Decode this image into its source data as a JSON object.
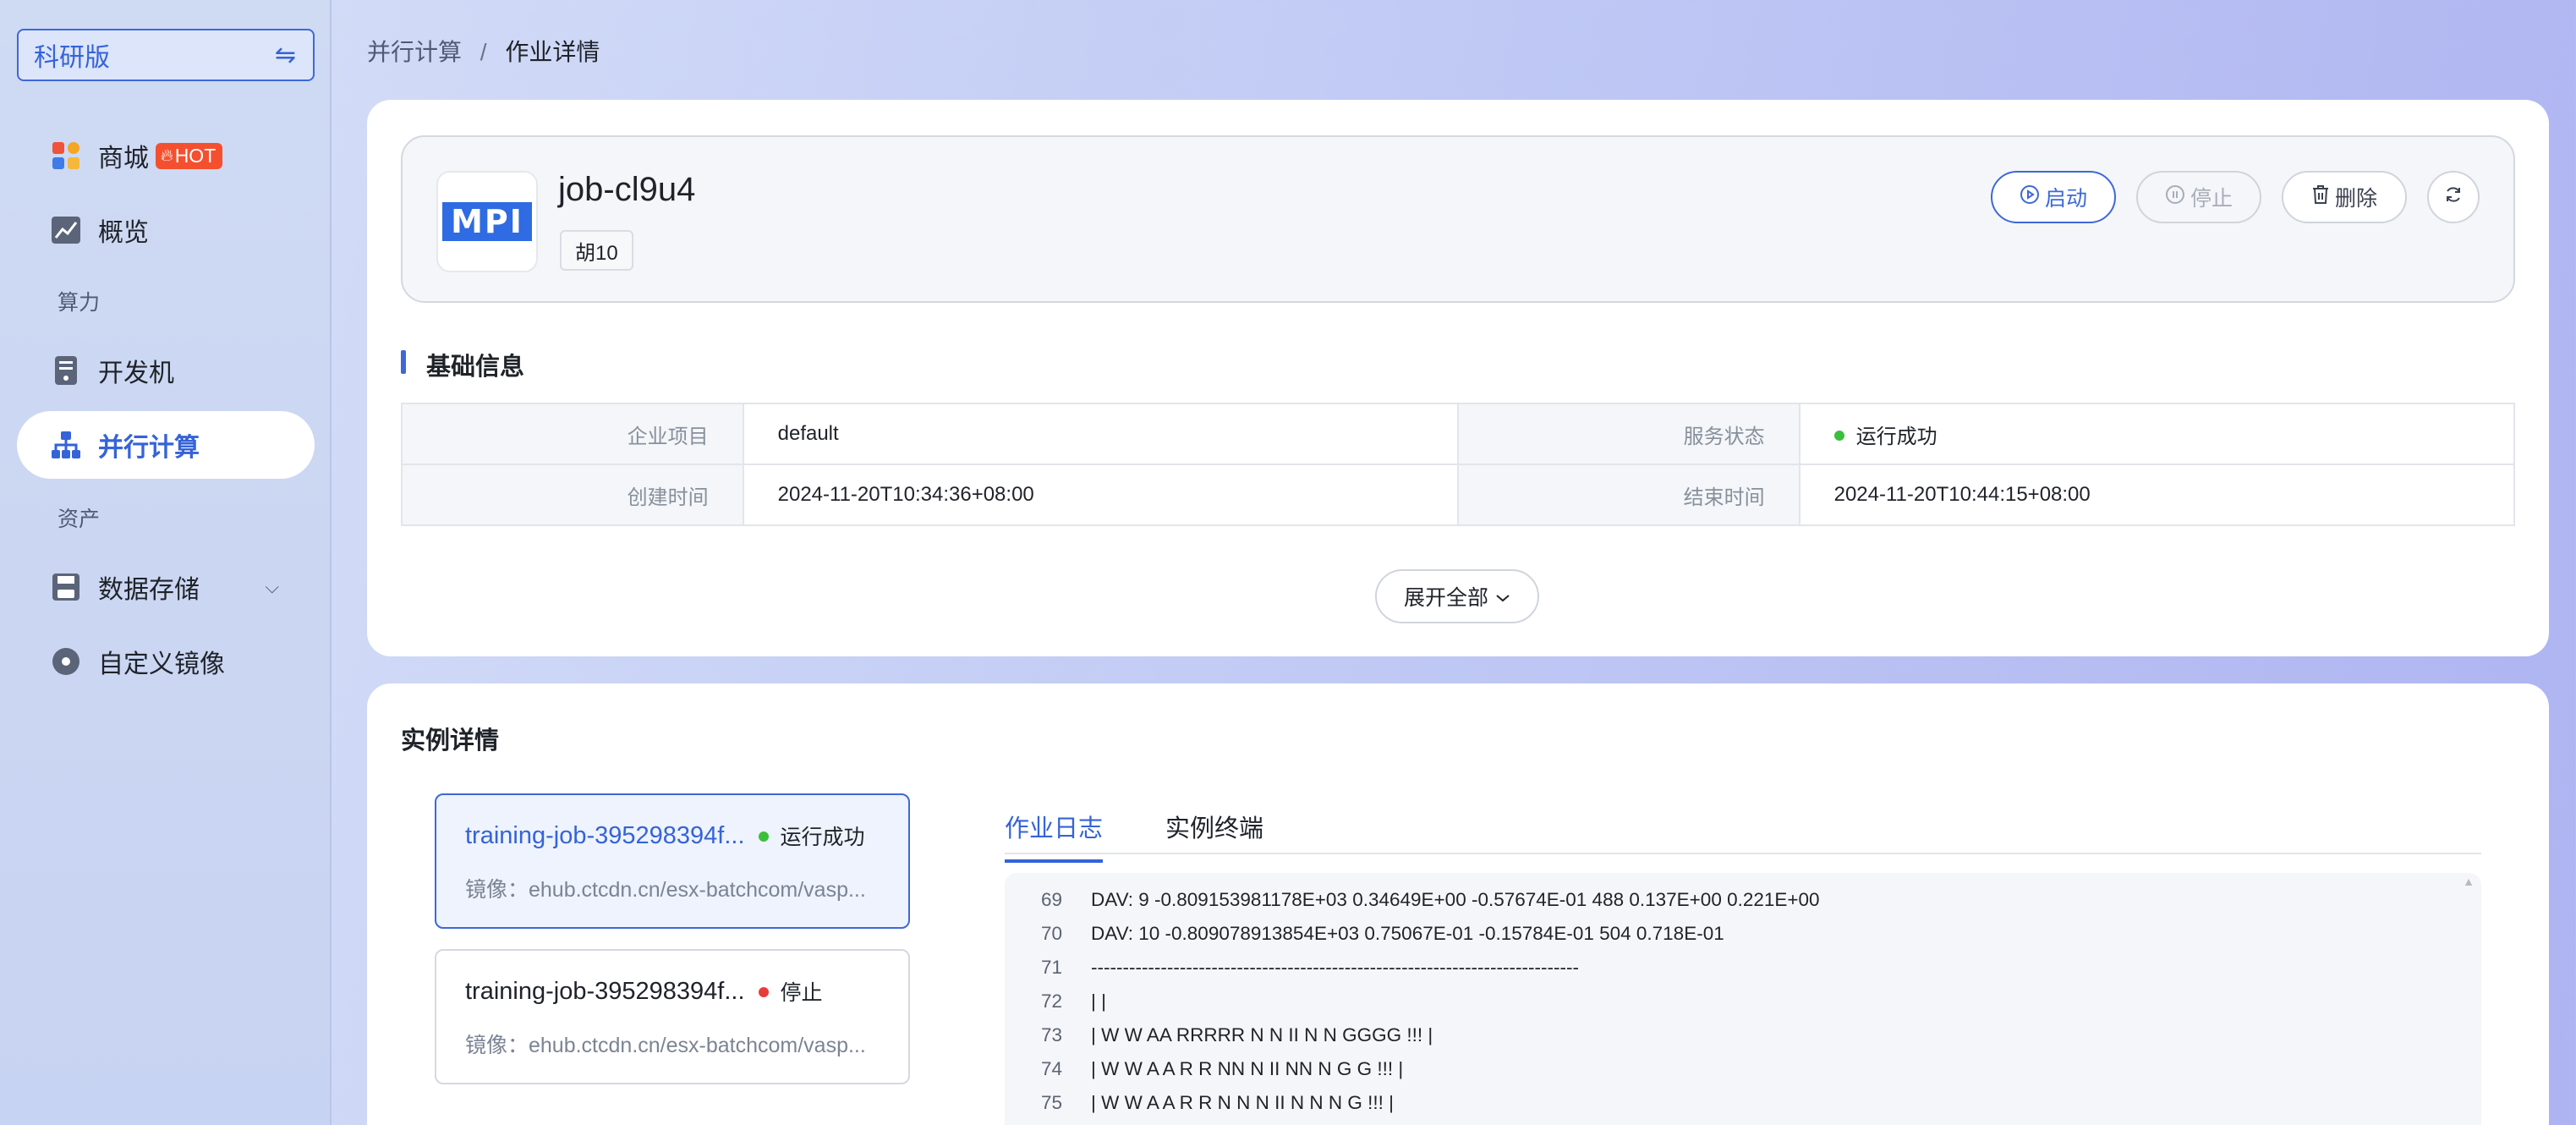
{
  "sidebar": {
    "edition_label": "科研版",
    "switch_icon": "⇋",
    "items": [
      {
        "label": "商城",
        "badge": "HOT"
      },
      {
        "label": "概览"
      },
      {
        "label": "开发机"
      },
      {
        "label": "并行计算"
      },
      {
        "label": "数据存储"
      },
      {
        "label": "自定义镜像"
      }
    ],
    "sections": [
      "算力",
      "资产"
    ]
  },
  "breadcrumb": {
    "parent": "并行计算",
    "separator": "/",
    "current": "作业详情"
  },
  "job": {
    "logo_text": "MPI",
    "name": "job-cl9u4",
    "tag": "胡10",
    "buttons": {
      "start": "启动",
      "stop": "停止",
      "delete": "删除"
    }
  },
  "basic_info": {
    "title": "基础信息",
    "rows": [
      {
        "k1": "企业项目",
        "v1": "default",
        "k2": "服务状态",
        "v2": "运行成功"
      },
      {
        "k1": "创建时间",
        "v1": "2024-11-20T10:34:36+08:00",
        "k2": "结束时间",
        "v2": "2024-11-20T10:44:15+08:00"
      }
    ],
    "expand_label": "展开全部"
  },
  "instances": {
    "title": "实例详情",
    "list": [
      {
        "name": "training-job-395298394f...",
        "status": "运行成功",
        "image": "镜像：ehub.ctcdn.cn/esx-batchcom/vasp..."
      },
      {
        "name": "training-job-395298394f...",
        "status": "停止",
        "image": "镜像：ehub.ctcdn.cn/esx-batchcom/vasp..."
      }
    ],
    "tabs": [
      "作业日志",
      "实例终端"
    ],
    "log": [
      {
        "n": "69",
        "text": "DAV: 9 -0.809153981178E+03 0.34649E+00 -0.57674E-01 488 0.137E+00 0.221E+00"
      },
      {
        "n": "70",
        "text": "DAV: 10 -0.809078913854E+03 0.75067E-01 -0.15784E-01 504 0.718E-01"
      },
      {
        "n": "71",
        "text": "-----------------------------------------------------------------------------"
      },
      {
        "n": "72",
        "text": "| |"
      },
      {
        "n": "73",
        "text": "| W W AA RRRRR N N II N N GGGG !!! |"
      },
      {
        "n": "74",
        "text": "| W W A A R R NN N II NN N G G !!! |"
      },
      {
        "n": "75",
        "text": "| W W A A R R N N N II N N N G !!! |"
      }
    ]
  },
  "colors": {
    "accent": "#3e68d8",
    "success": "#3bbf3b",
    "danger": "#ea3b3b",
    "hot": "#f4502f"
  }
}
